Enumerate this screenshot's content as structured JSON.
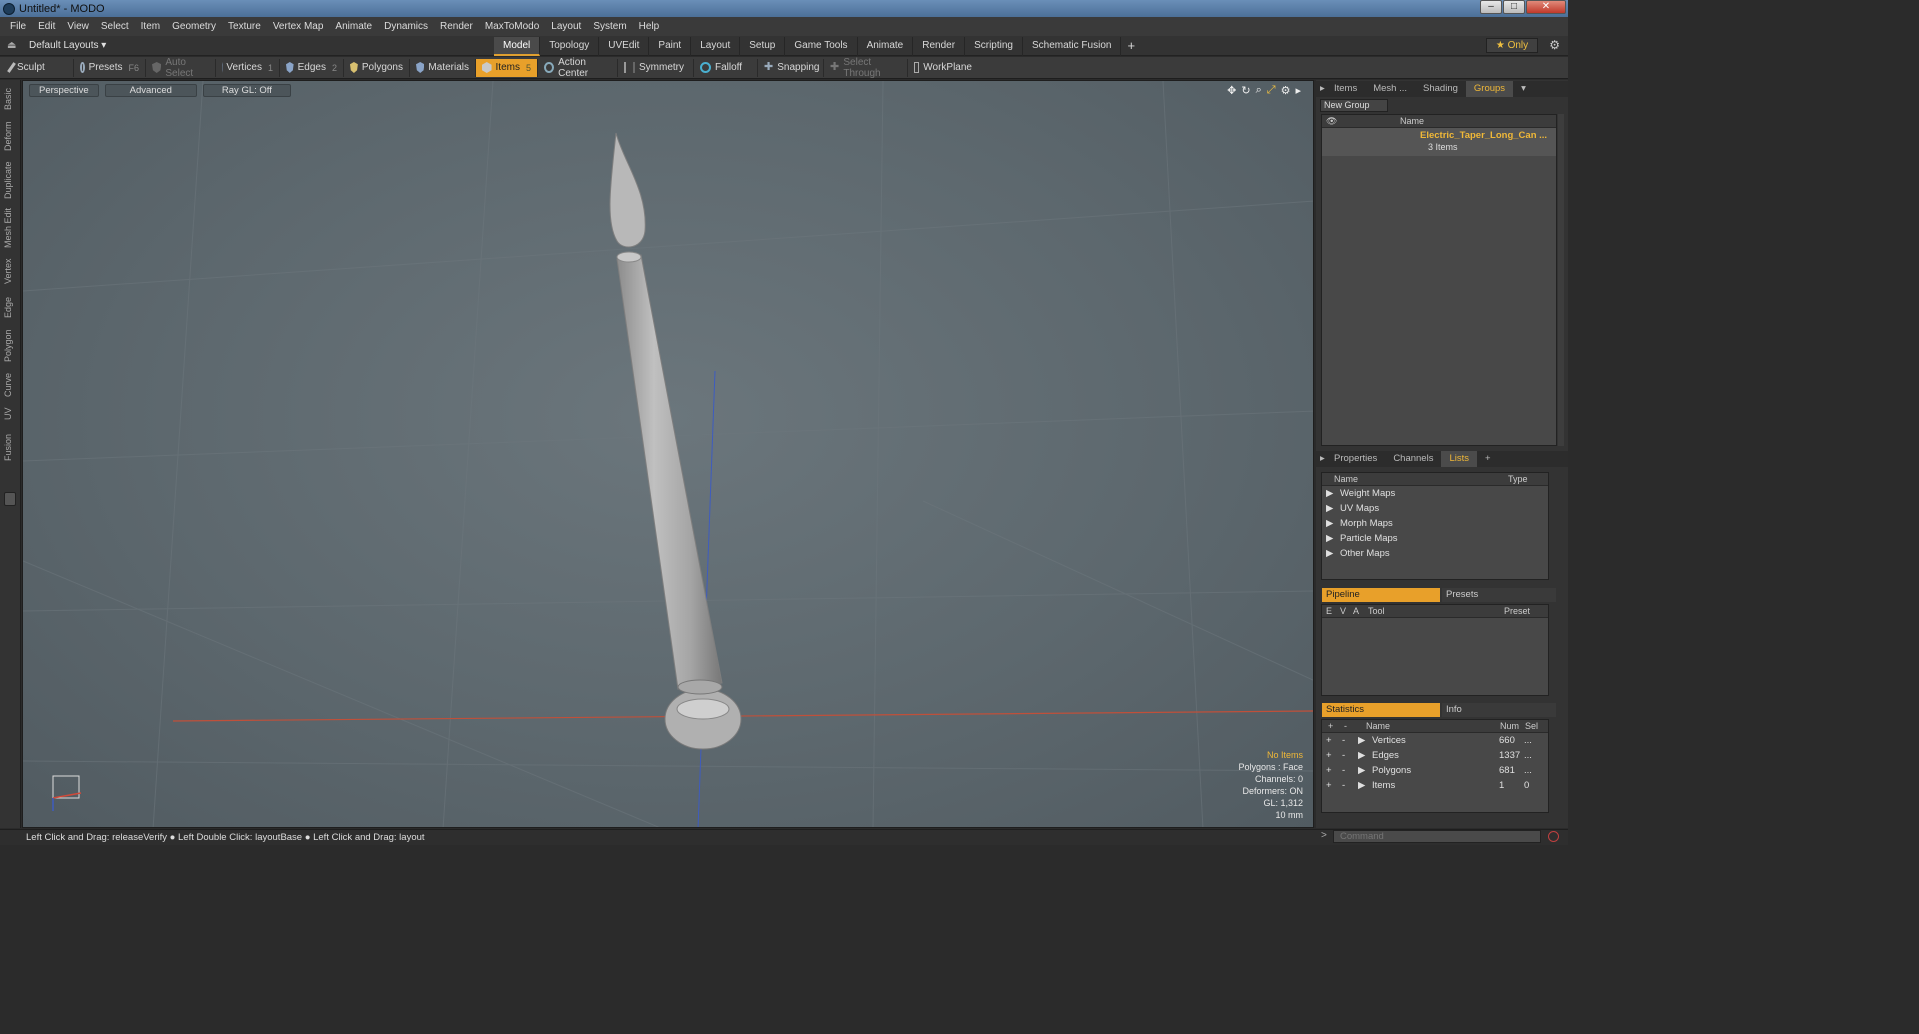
{
  "window": {
    "title": "Untitled* - MODO"
  },
  "menu": [
    "File",
    "Edit",
    "View",
    "Select",
    "Item",
    "Geometry",
    "Texture",
    "Vertex Map",
    "Animate",
    "Dynamics",
    "Render",
    "MaxToModo",
    "Layout",
    "System",
    "Help"
  ],
  "layout_bar": {
    "layout_selector": "Default Layouts ▾",
    "tabs": [
      "Model",
      "Topology",
      "UVEdit",
      "Paint",
      "Layout",
      "Setup",
      "Game Tools",
      "Animate",
      "Render",
      "Scripting",
      "Schematic Fusion"
    ],
    "active_tab": "Model",
    "only_label": "★ Only"
  },
  "toolbar": {
    "sculpt": "Sculpt",
    "presets": "Presets",
    "presets_key": "F6",
    "auto_select": "Auto Select",
    "vertices": "Vertices",
    "vertices_key": "1",
    "edges": "Edges",
    "edges_key": "2",
    "polygons": "Polygons",
    "materials": "Materials",
    "items": "Items",
    "items_key": "5",
    "action_center": "Action Center",
    "symmetry": "Symmetry",
    "falloff": "Falloff",
    "snapping": "Snapping",
    "select_through": "Select Through",
    "workplane": "WorkPlane"
  },
  "left_tabs": [
    "Basic",
    "Deform",
    "Duplicate",
    "Mesh Edit",
    "Vertex",
    "Edge",
    "Polygon",
    "Curve",
    "UV",
    "Fusion"
  ],
  "viewport": {
    "view_mode": "Perspective",
    "shading_mode": "Advanced",
    "raygl": "Ray GL: Off",
    "stats": {
      "selection": "No Items",
      "polygons": "Polygons : Face",
      "channels": "Channels: 0",
      "deformers": "Deformers: ON",
      "gl": "GL: 1,312",
      "scale": "10 mm"
    }
  },
  "groups_panel": {
    "tabs": [
      "Items",
      "Mesh ...",
      "Shading",
      "Groups"
    ],
    "active_tab": "Groups",
    "new_group": "New Group",
    "col_name": "Name",
    "group_name": "Electric_Taper_Long_Can ...",
    "group_count": "3 Items"
  },
  "lists_panel": {
    "tabs": [
      "Properties",
      "Channels",
      "Lists"
    ],
    "active_tab": "Lists",
    "col_name": "Name",
    "col_type": "Type",
    "items": [
      "Weight Maps",
      "UV Maps",
      "Morph Maps",
      "Particle Maps",
      "Other Maps"
    ]
  },
  "pipeline_panel": {
    "tab_pipeline": "Pipeline",
    "tab_presets": "Presets",
    "col_e": "E",
    "col_v": "V",
    "col_a": "A",
    "col_tool": "Tool",
    "col_preset": "Preset"
  },
  "statistics_panel": {
    "tab_statistics": "Statistics",
    "tab_info": "Info",
    "col_name": "Name",
    "col_num": "Num",
    "col_sel": "Sel",
    "rows": [
      {
        "name": "Vertices",
        "num": "660",
        "sel": "..."
      },
      {
        "name": "Edges",
        "num": "1337",
        "sel": "..."
      },
      {
        "name": "Polygons",
        "num": "681",
        "sel": "..."
      },
      {
        "name": "Items",
        "num": "1",
        "sel": "0"
      }
    ]
  },
  "statusbar": {
    "text": "Left Click and Drag: releaseVerify ● Left Double Click: layoutBase ● Left Click and Drag: layout"
  },
  "command": {
    "placeholder": "Command"
  }
}
